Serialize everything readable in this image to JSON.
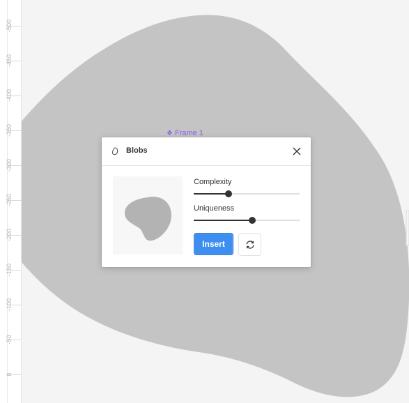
{
  "ruler": {
    "ticks": [
      "-500",
      "-450",
      "-400",
      "-350",
      "-300",
      "-250",
      "-200",
      "-150",
      "-100",
      "-50",
      "0"
    ]
  },
  "canvas": {
    "frame_label": "Frame 1",
    "frame_icon": "component-icon",
    "blob_color": "#c4c4c4"
  },
  "dialog": {
    "title": "Blobs",
    "plugin_icon": "blob-icon",
    "close_icon": "close-icon",
    "complexity": {
      "label": "Complexity",
      "value": 0.33
    },
    "uniqueness": {
      "label": "Uniqueness",
      "value": 0.55
    },
    "insert_label": "Insert",
    "refresh_icon": "refresh-icon",
    "accent": "#3d8ef0",
    "preview_blob_color": "#b3b3b3"
  }
}
